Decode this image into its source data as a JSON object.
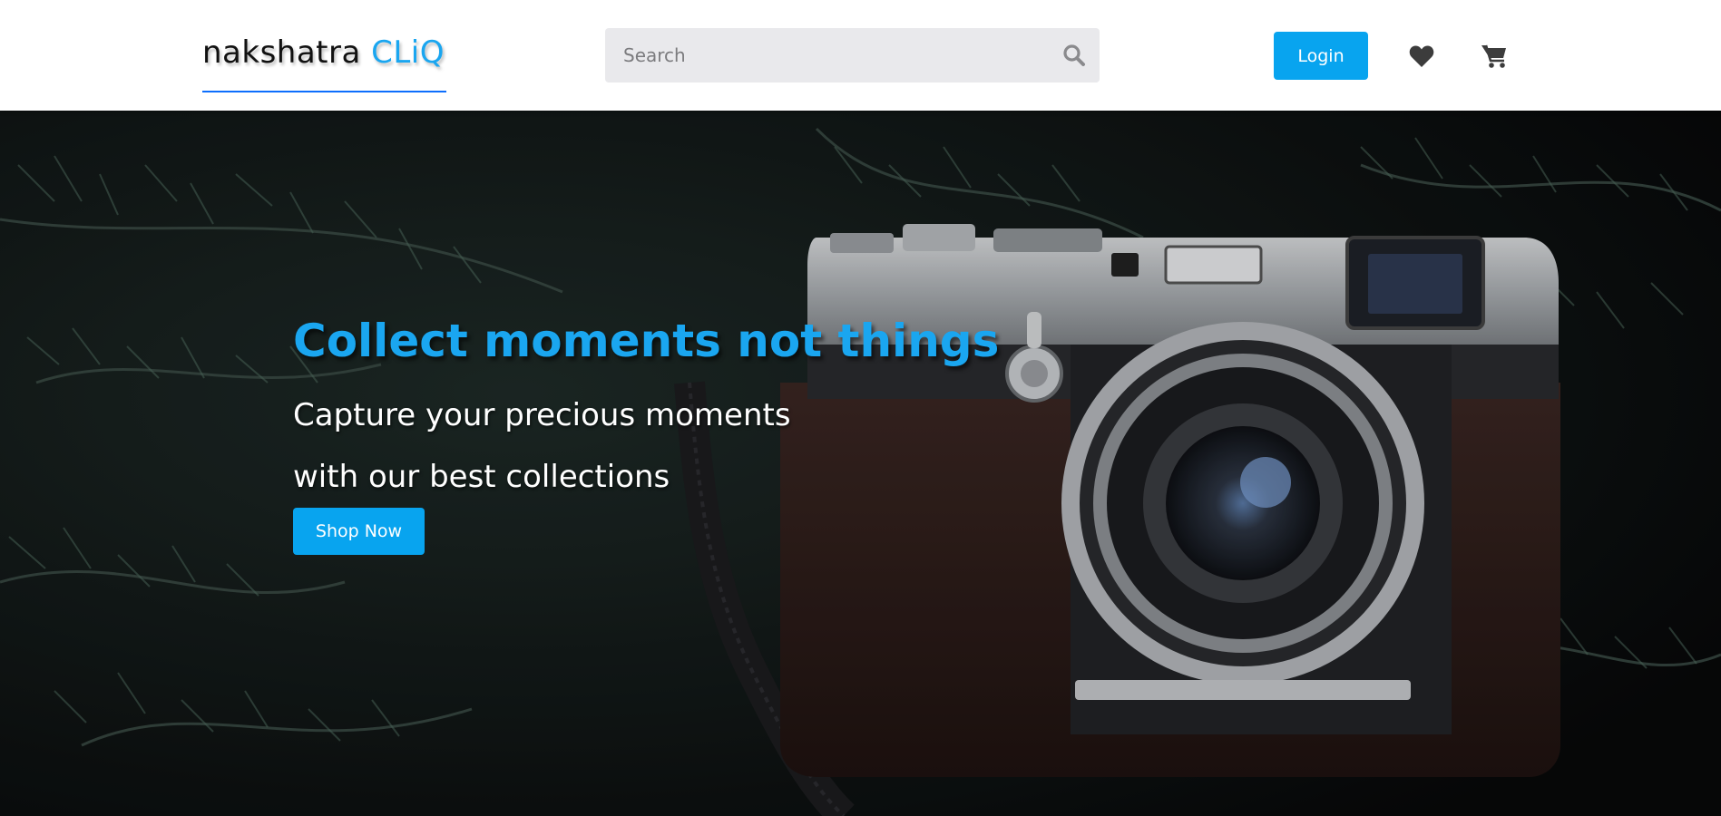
{
  "header": {
    "logo": {
      "main": "nakshatra ",
      "accent": "CLiQ"
    },
    "search": {
      "placeholder": "Search",
      "value": ""
    },
    "login_label": "Login",
    "wishlist_icon": "heart-icon",
    "cart_icon": "cart-icon"
  },
  "hero": {
    "title": "Collect moments not things",
    "subtitle_line1": "Capture your precious moments",
    "subtitle_line2": "with our best collections",
    "cta_label": "Shop Now",
    "background": "camera-on-pine-branches-photo"
  },
  "colors": {
    "accent": "#08a4ef",
    "logo_underline": "#0d6efd",
    "search_bg": "#e9e9ec"
  }
}
